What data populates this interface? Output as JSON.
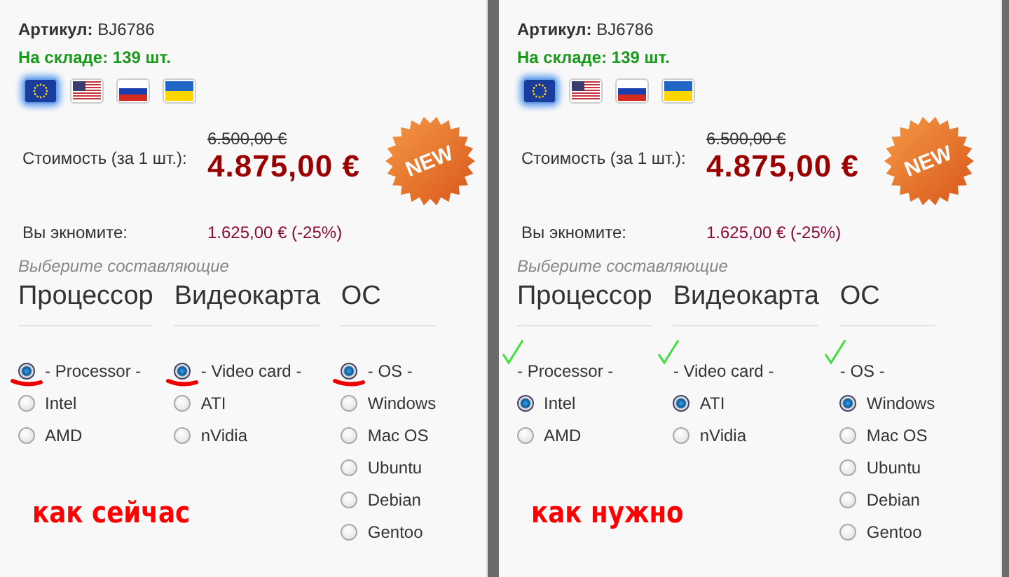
{
  "panels": [
    {
      "sku_label": "Артикул:",
      "sku": "BJ6786",
      "stock": "На складе: 139 шт.",
      "flags": [
        {
          "kind": "eu",
          "selected": true
        },
        {
          "kind": "us",
          "selected": false
        },
        {
          "kind": "ru",
          "selected": false
        },
        {
          "kind": "ua",
          "selected": false
        }
      ],
      "price_label": "Стоимость (за 1 шт.):",
      "old_price": "6.500,00 €",
      "price": "4.875,00 €",
      "badge": "NEW",
      "savings_label": "Вы экномите:",
      "savings": "1.625,00 € (-25%)",
      "choose_label": "Выберите составляющие",
      "groups": [
        {
          "title": "Процессор",
          "options": [
            {
              "kind": "radio",
              "label": "- Processor -",
              "selected": true,
              "underlined": true,
              "ticked": false
            },
            {
              "kind": "radio",
              "label": "Intel",
              "selected": false,
              "underlined": false,
              "ticked": false
            },
            {
              "kind": "radio",
              "label": "AMD",
              "selected": false,
              "underlined": false,
              "ticked": false
            }
          ]
        },
        {
          "title": "Видеокарта",
          "options": [
            {
              "kind": "radio",
              "label": "- Video card -",
              "selected": true,
              "underlined": true,
              "ticked": false
            },
            {
              "kind": "radio",
              "label": "ATI",
              "selected": false,
              "underlined": false,
              "ticked": false
            },
            {
              "kind": "radio",
              "label": "nVidia",
              "selected": false,
              "underlined": false,
              "ticked": false
            }
          ]
        },
        {
          "title": "ОС",
          "options": [
            {
              "kind": "radio",
              "label": "- OS -",
              "selected": true,
              "underlined": true,
              "ticked": false
            },
            {
              "kind": "radio",
              "label": "Windows",
              "selected": false,
              "underlined": false,
              "ticked": false
            },
            {
              "kind": "radio",
              "label": "Mac OS",
              "selected": false,
              "underlined": false,
              "ticked": false
            },
            {
              "kind": "radio",
              "label": "Ubuntu",
              "selected": false,
              "underlined": false,
              "ticked": false
            },
            {
              "kind": "radio",
              "label": "Debian",
              "selected": false,
              "underlined": false,
              "ticked": false
            },
            {
              "kind": "radio",
              "label": "Gentoo",
              "selected": false,
              "underlined": false,
              "ticked": false
            }
          ]
        }
      ],
      "caption": "как сейчас"
    },
    {
      "sku_label": "Артикул:",
      "sku": "BJ6786",
      "stock": "На складе: 139 шт.",
      "flags": [
        {
          "kind": "eu",
          "selected": true
        },
        {
          "kind": "us",
          "selected": false
        },
        {
          "kind": "ru",
          "selected": false
        },
        {
          "kind": "ua",
          "selected": false
        }
      ],
      "price_label": "Стоимость (за 1 шт.):",
      "old_price": "6.500,00 €",
      "price": "4.875,00 €",
      "badge": "NEW",
      "savings_label": "Вы экномите:",
      "savings": "1.625,00 € (-25%)",
      "choose_label": "Выберите составляющие",
      "groups": [
        {
          "title": "Процессор",
          "options": [
            {
              "kind": "heading",
              "label": "- Processor -",
              "underlined": false,
              "ticked": true
            },
            {
              "kind": "radio",
              "label": "Intel",
              "selected": true,
              "underlined": false,
              "ticked": false
            },
            {
              "kind": "radio",
              "label": "AMD",
              "selected": false,
              "underlined": false,
              "ticked": false
            }
          ]
        },
        {
          "title": "Видеокарта",
          "options": [
            {
              "kind": "heading",
              "label": "- Video card -",
              "underlined": false,
              "ticked": true
            },
            {
              "kind": "radio",
              "label": "ATI",
              "selected": true,
              "underlined": false,
              "ticked": false
            },
            {
              "kind": "radio",
              "label": "nVidia",
              "selected": false,
              "underlined": false,
              "ticked": false
            }
          ]
        },
        {
          "title": "ОС",
          "options": [
            {
              "kind": "heading",
              "label": "- OS -",
              "underlined": false,
              "ticked": true
            },
            {
              "kind": "radio",
              "label": "Windows",
              "selected": true,
              "underlined": false,
              "ticked": false
            },
            {
              "kind": "radio",
              "label": "Mac OS",
              "selected": false,
              "underlined": false,
              "ticked": false
            },
            {
              "kind": "radio",
              "label": "Ubuntu",
              "selected": false,
              "underlined": false,
              "ticked": false
            },
            {
              "kind": "radio",
              "label": "Debian",
              "selected": false,
              "underlined": false,
              "ticked": false
            },
            {
              "kind": "radio",
              "label": "Gentoo",
              "selected": false,
              "underlined": false,
              "ticked": false
            }
          ]
        }
      ],
      "caption": "как нужно"
    }
  ]
}
